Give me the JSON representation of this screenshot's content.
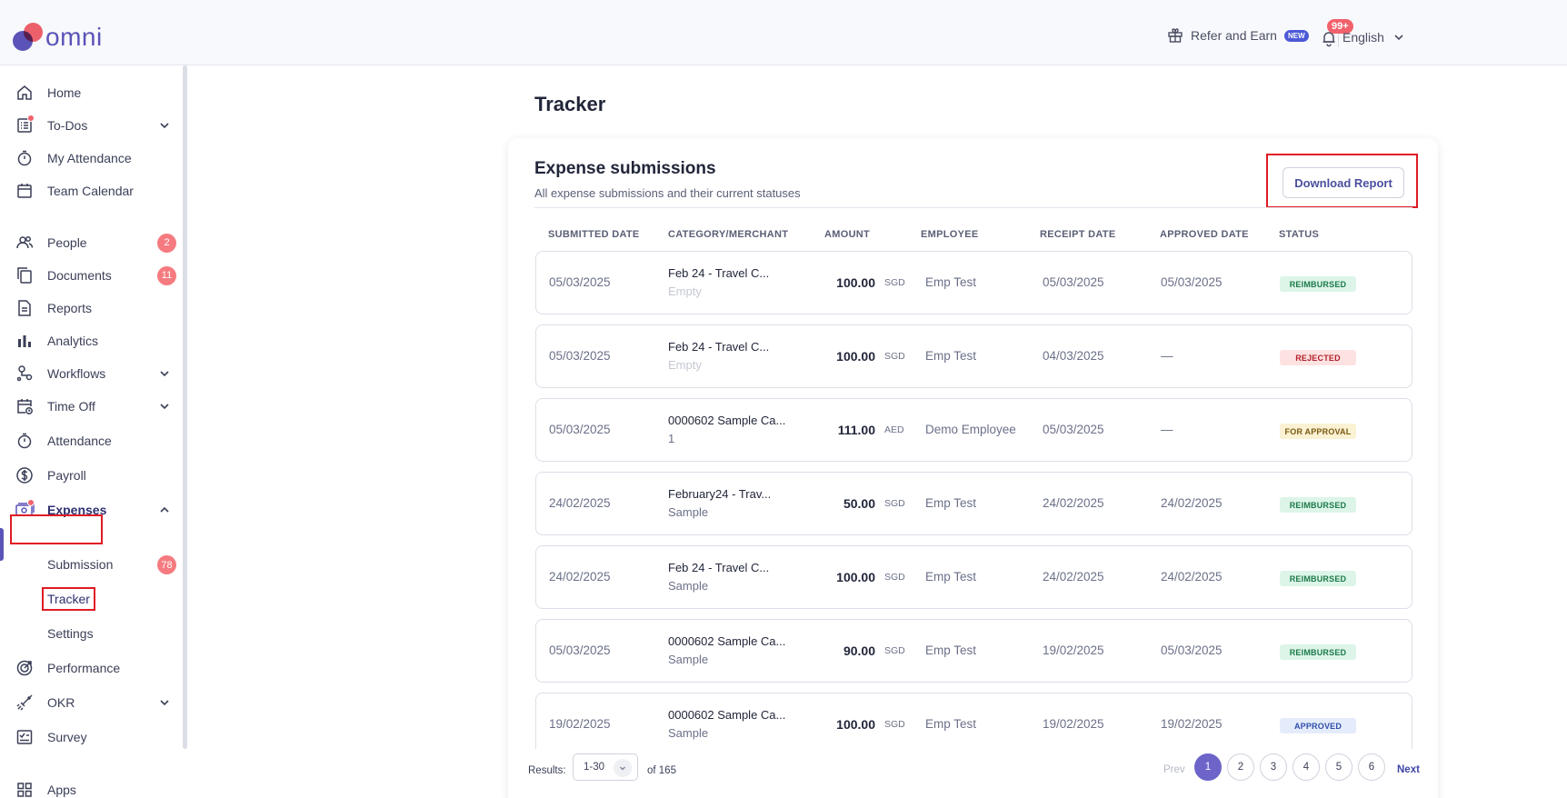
{
  "app": {
    "brand": "omni"
  },
  "topbar": {
    "refer_label": "Refer and Earn",
    "new_badge": "NEW",
    "notifications": "99+",
    "language": "English"
  },
  "sidebar": {
    "items": [
      {
        "label": "Home",
        "icon": "home-icon"
      },
      {
        "label": "To-Dos",
        "icon": "todo-list-icon"
      },
      {
        "label": "My Attendance",
        "icon": "stopwatch-icon"
      },
      {
        "label": "Team Calendar",
        "icon": "calendar-icon"
      },
      {
        "label": "People",
        "icon": "people-icon",
        "count": "2"
      },
      {
        "label": "Documents",
        "icon": "documents-icon",
        "count": "11"
      },
      {
        "label": "Reports",
        "icon": "report-icon"
      },
      {
        "label": "Analytics",
        "icon": "bar-chart-icon"
      },
      {
        "label": "Workflows",
        "icon": "workflow-icon"
      },
      {
        "label": "Time Off",
        "icon": "calendar-clock-icon"
      },
      {
        "label": "Attendance",
        "icon": "stopwatch-icon"
      },
      {
        "label": "Payroll",
        "icon": "dollar-icon"
      },
      {
        "label": "Expenses",
        "icon": "money-icon"
      },
      {
        "label": "Performance",
        "icon": "target-icon"
      },
      {
        "label": "OKR",
        "icon": "rocket-icon"
      },
      {
        "label": "Survey",
        "icon": "checkbox-board-icon"
      },
      {
        "label": "Apps",
        "icon": "apps-grid-icon"
      }
    ],
    "expenses_sub": [
      {
        "label": "Submission",
        "count": "78"
      },
      {
        "label": "Tracker"
      },
      {
        "label": "Settings"
      }
    ]
  },
  "page": {
    "title": "Tracker"
  },
  "card": {
    "title": "Expense submissions",
    "subtitle": "All expense submissions and their current statuses",
    "download_label": "Download Report"
  },
  "table": {
    "headers": [
      "SUBMITTED DATE",
      "CATEGORY/MERCHANT",
      "AMOUNT",
      "EMPLOYEE",
      "RECEIPT DATE",
      "APPROVED DATE",
      "STATUS"
    ],
    "rows": [
      {
        "submitted": "05/03/2025",
        "cat": "Feb 24 - Travel C...",
        "merchant": "Empty",
        "amount": "100.00",
        "currency": "SGD",
        "employee": "Emp Test",
        "receipt": "05/03/2025",
        "approved": "05/03/2025",
        "status": "REIMBURSED",
        "kind": "reimbursed"
      },
      {
        "submitted": "05/03/2025",
        "cat": "Feb 24 - Travel C...",
        "merchant": "Empty",
        "amount": "100.00",
        "currency": "SGD",
        "employee": "Emp Test",
        "receipt": "04/03/2025",
        "approved": "—",
        "status": "REJECTED",
        "kind": "rejected"
      },
      {
        "submitted": "05/03/2025",
        "cat": "0000602 Sample Ca...",
        "merchant": "1",
        "amount": "111.00",
        "currency": "AED",
        "employee": "Demo Employee",
        "receipt": "05/03/2025",
        "approved": "—",
        "status": "FOR APPROVAL",
        "kind": "approval"
      },
      {
        "submitted": "24/02/2025",
        "cat": "February24 - Trav...",
        "merchant": "Sample",
        "amount": "50.00",
        "currency": "SGD",
        "employee": "Emp Test",
        "receipt": "24/02/2025",
        "approved": "24/02/2025",
        "status": "REIMBURSED",
        "kind": "reimbursed"
      },
      {
        "submitted": "24/02/2025",
        "cat": "Feb 24 - Travel C...",
        "merchant": "Sample",
        "amount": "100.00",
        "currency": "SGD",
        "employee": "Emp Test",
        "receipt": "24/02/2025",
        "approved": "24/02/2025",
        "status": "REIMBURSED",
        "kind": "reimbursed"
      },
      {
        "submitted": "05/03/2025",
        "cat": "0000602 Sample Ca...",
        "merchant": "Sample",
        "amount": "90.00",
        "currency": "SGD",
        "employee": "Emp Test",
        "receipt": "19/02/2025",
        "approved": "05/03/2025",
        "status": "REIMBURSED",
        "kind": "reimbursed"
      },
      {
        "submitted": "19/02/2025",
        "cat": "0000602 Sample Ca...",
        "merchant": "Sample",
        "amount": "100.00",
        "currency": "SGD",
        "employee": "Emp Test",
        "receipt": "19/02/2025",
        "approved": "19/02/2025",
        "status": "APPROVED",
        "kind": "approved"
      }
    ]
  },
  "pagination": {
    "results_label": "Results:",
    "range": "1-30",
    "of_total": "of 165",
    "prev": "Prev",
    "next": "Next",
    "pages": [
      "1",
      "2",
      "3",
      "4",
      "5",
      "6"
    ]
  }
}
